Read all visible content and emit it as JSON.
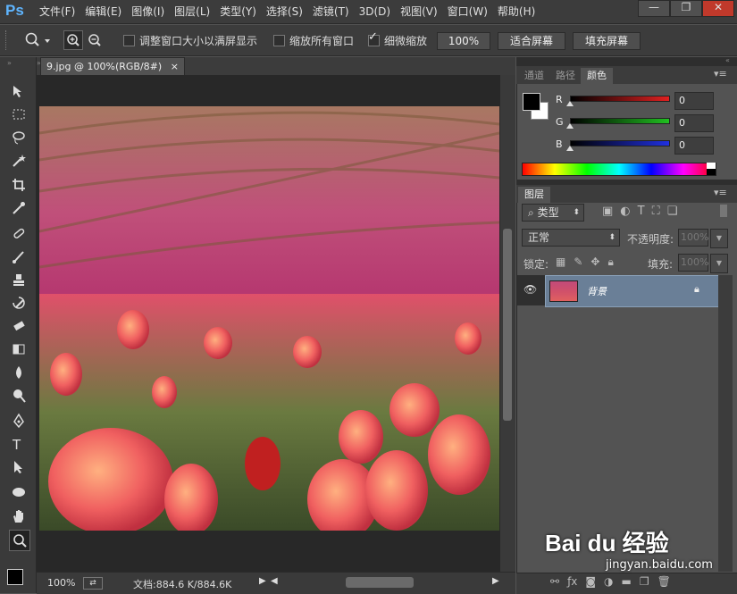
{
  "app": {
    "logo": "Ps"
  },
  "menu": [
    "文件(F)",
    "编辑(E)",
    "图像(I)",
    "图层(L)",
    "类型(Y)",
    "选择(S)",
    "滤镜(T)",
    "3D(D)",
    "视图(V)",
    "窗口(W)",
    "帮助(H)"
  ],
  "window_controls": {
    "minimize": "—",
    "restore": "❐",
    "close": "✕"
  },
  "options": {
    "resize_windows_label": "调整窗口大小以满屏显示",
    "zoom_all_label": "缩放所有窗口",
    "scrubby_zoom_label": "细微缩放",
    "btn_100": "100%",
    "btn_fit": "适合屏幕",
    "btn_fill": "填充屏幕"
  },
  "document": {
    "tab_title": "9.jpg @ 100%(RGB/8#)",
    "tab_close": "×",
    "zoom": "100%",
    "doc_info": "文档:884.6 K/884.6K"
  },
  "color_panel": {
    "tabs": [
      "通道",
      "路径",
      "颜色"
    ],
    "active_tab": "颜色",
    "sliders": [
      {
        "label": "R",
        "value": "0",
        "color": "#e02020"
      },
      {
        "label": "G",
        "value": "0",
        "color": "#20c020"
      },
      {
        "label": "B",
        "value": "0",
        "color": "#2030e0"
      }
    ]
  },
  "layers_panel": {
    "tab": "图层",
    "filter_kind": "类型",
    "blend_mode": "正常",
    "opacity_label": "不透明度:",
    "opacity_value": "100%",
    "lock_label": "锁定:",
    "fill_label": "填充:",
    "fill_value": "100%",
    "layers": [
      {
        "name": "背景",
        "visible": true,
        "locked": true
      }
    ]
  },
  "watermark": {
    "text": "Bai du 经验",
    "url": "jingyan.baidu.com"
  }
}
